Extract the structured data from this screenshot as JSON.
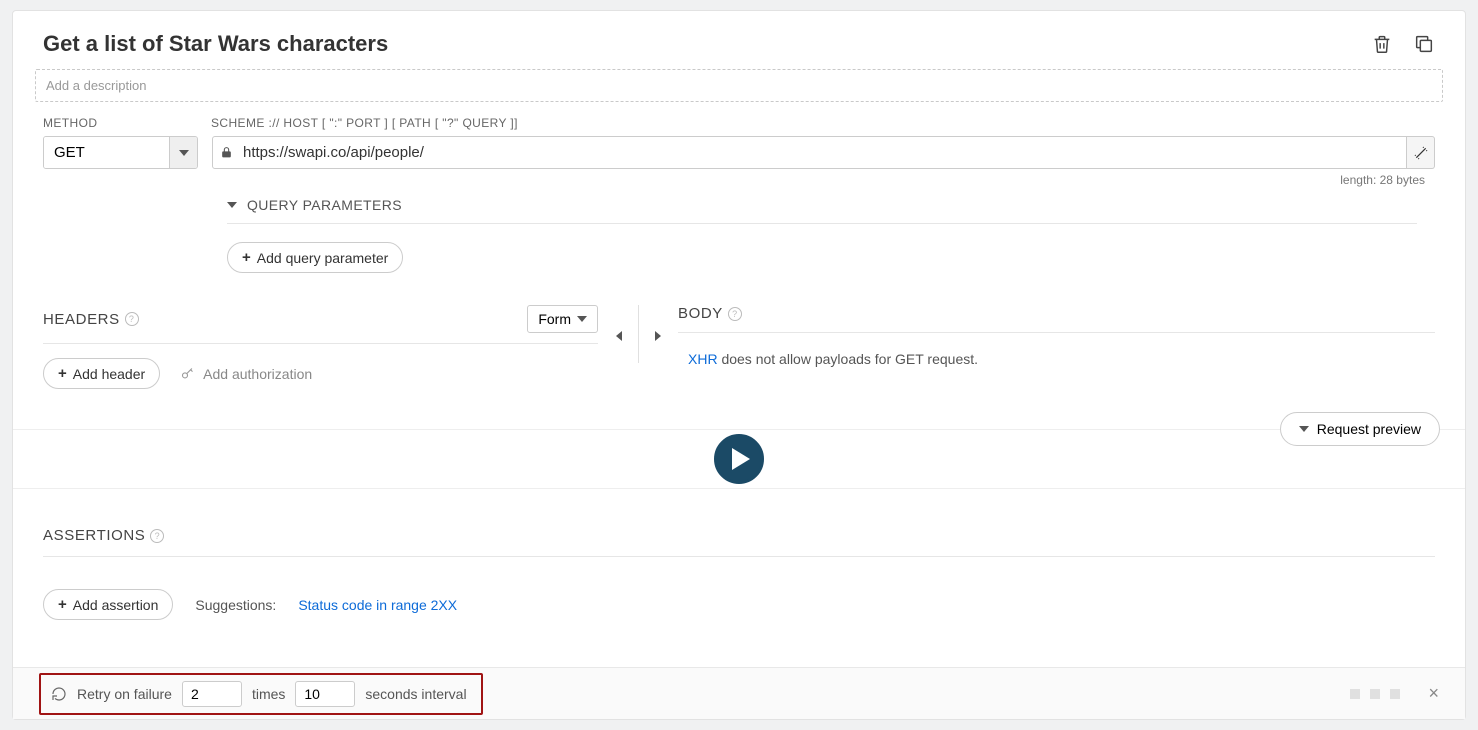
{
  "title": "Get a list of Star Wars characters",
  "description_placeholder": "Add a description",
  "method": {
    "label": "METHOD",
    "value": "GET"
  },
  "url": {
    "label": "SCHEME :// HOST [ \":\" PORT ] [ PATH [ \"?\" QUERY ]]",
    "value": "https://swapi.co/api/people/",
    "length_text": "length: 28 bytes"
  },
  "query_params": {
    "title": "QUERY PARAMETERS",
    "add_btn": "Add query parameter"
  },
  "headers": {
    "title": "HEADERS",
    "form_dd": "Form",
    "add_btn": "Add header",
    "auth_btn": "Add authorization"
  },
  "body": {
    "title": "BODY",
    "xhr": "XHR",
    "msg": " does not allow payloads for GET request."
  },
  "request_preview": "Request preview",
  "assertions": {
    "title": "ASSERTIONS",
    "add_btn": "Add assertion",
    "suggestions_label": "Suggestions:",
    "suggestion_link": "Status code in range 2XX"
  },
  "retry": {
    "label": "Retry on failure",
    "times_value": "2",
    "times_label": "times",
    "interval_value": "10",
    "interval_label": "seconds interval"
  }
}
